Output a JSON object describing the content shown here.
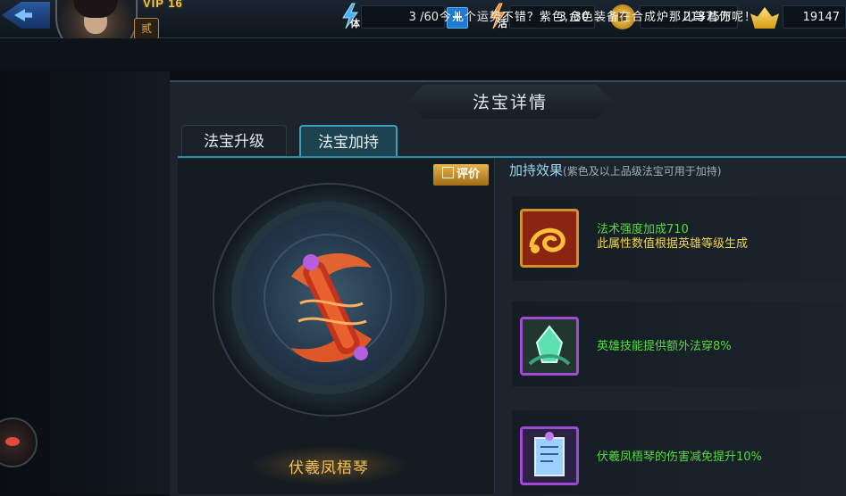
{
  "header": {
    "vip_label": "VIP 16",
    "rank_label": "贰",
    "stamina": {
      "label": "体",
      "value": "3 /60"
    },
    "energy": {
      "label": "活",
      "value": "3 /30"
    },
    "coins": {
      "value": "21375万"
    },
    "gold": {
      "value": "19147"
    },
    "plus_label": "+"
  },
  "tip": "今儿个运势不错？紫色,金色装备在合成炉那儿等着你呢！",
  "panel": {
    "title": "法宝详情",
    "tabs": [
      {
        "label": "法宝升级",
        "active": false
      },
      {
        "label": "法宝加持",
        "active": true
      }
    ],
    "rate_button": "评价",
    "treasure_name": "伏羲凤梧琴",
    "effects_title": "加持效果",
    "effects_note": "(紫色及以上品级法宝可用于加持)",
    "effects": [
      {
        "icon": "serpent-seal-icon",
        "line1": "法术强度加成710",
        "line2": "此属性数值根据英雄等级生成"
      },
      {
        "icon": "jade-crystal-icon",
        "line1": "英雄技能提供额外法穿8%"
      },
      {
        "icon": "scroll-talisman-icon",
        "line1": "伏羲凤梧琴的伤害减免提升10%"
      }
    ]
  },
  "colors": {
    "accent": "#3aa0c0",
    "effect_green": "#56d93f",
    "effect_yellow": "#f0d64a",
    "gold_text": "#f3c35a"
  }
}
